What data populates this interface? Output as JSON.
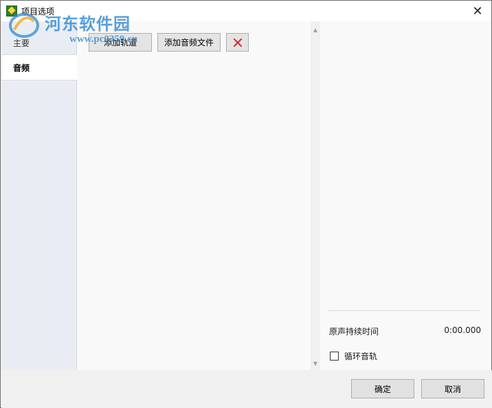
{
  "window": {
    "title": "项目选项",
    "close_glyph": "✕"
  },
  "watermark": {
    "title": "河东软件园",
    "url": "www.pc0359.cn"
  },
  "sidebar": {
    "tabs": [
      {
        "label": "主要",
        "active": false
      },
      {
        "label": "音频",
        "active": true
      }
    ]
  },
  "toolbar": {
    "add_track_label": "添加轨道",
    "add_audio_label": "添加音频文件",
    "delete_icon": "delete-x-icon",
    "delete_color": "#d9232e"
  },
  "scrollbar": {
    "up_glyph": "▲",
    "down_glyph": "▼"
  },
  "right_panel": {
    "duration_label": "原声持续时间",
    "duration_value": "0:00.000",
    "loop_label": "循环音轨",
    "loop_checked": false
  },
  "footer": {
    "ok_label": "确定",
    "cancel_label": "取消"
  }
}
